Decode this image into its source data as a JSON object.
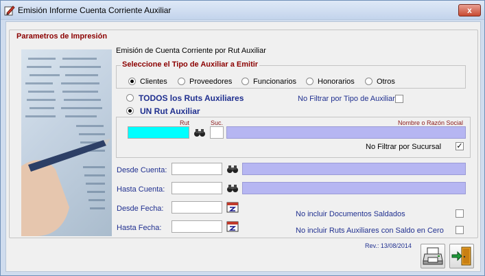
{
  "window": {
    "title": "Emisión Informe Cuenta Corriente Auxiliar",
    "close_label": "x"
  },
  "main_group": {
    "legend": "Parametros de Impresión",
    "subtitle": "Emisión de Cuenta Corriente por Rut Auxiliar"
  },
  "tipo_auxiliar": {
    "legend": "Seleccione el Tipo de Auxiliar a Emitir",
    "options": [
      {
        "label": "Clientes",
        "selected": true
      },
      {
        "label": "Proveedores",
        "selected": false
      },
      {
        "label": "Funcionarios",
        "selected": false
      },
      {
        "label": "Honorarios",
        "selected": false
      },
      {
        "label": "Otros",
        "selected": false
      }
    ]
  },
  "rut_scope": {
    "todos_label": "TODOS los Ruts Auxiliares",
    "no_filtrar_tipo_label": "No Filtrar por Tipo de Auxiliar",
    "no_filtrar_tipo_checked": false,
    "un_rut_label": "UN Rut Auxiliar",
    "selected": "un_rut"
  },
  "un_rut": {
    "rut_label": "Rut",
    "suc_label": "Suc.",
    "nombre_label": "Nombre o Razón Social",
    "rut_value": "",
    "suc_value": "",
    "nombre_value": "",
    "no_filtrar_sucursal_label": "No Filtrar por Sucursal",
    "no_filtrar_sucursal_checked": true
  },
  "cuentas": {
    "desde_label": "Desde Cuenta:",
    "hasta_label": "Hasta Cuenta:",
    "desde_value": "",
    "hasta_value": "",
    "desde_desc": "",
    "hasta_desc": ""
  },
  "fechas": {
    "desde_label": "Desde Fecha:",
    "hasta_label": "Hasta Fecha:",
    "desde_value": "",
    "hasta_value": ""
  },
  "options": {
    "no_saldados_label": "No incluir Documentos Saldados",
    "no_saldados_checked": false,
    "no_saldo_cero_label": "No incluir Ruts Auxiliares con Saldo en Cero",
    "no_saldo_cero_checked": false
  },
  "footer": {
    "rev": "Rev.: 13/08/2014"
  },
  "colors": {
    "accent_red": "#8b0000",
    "label_blue": "#1f2f8f",
    "rut_field": "#00ffff",
    "name_field": "#b6b6f2"
  }
}
